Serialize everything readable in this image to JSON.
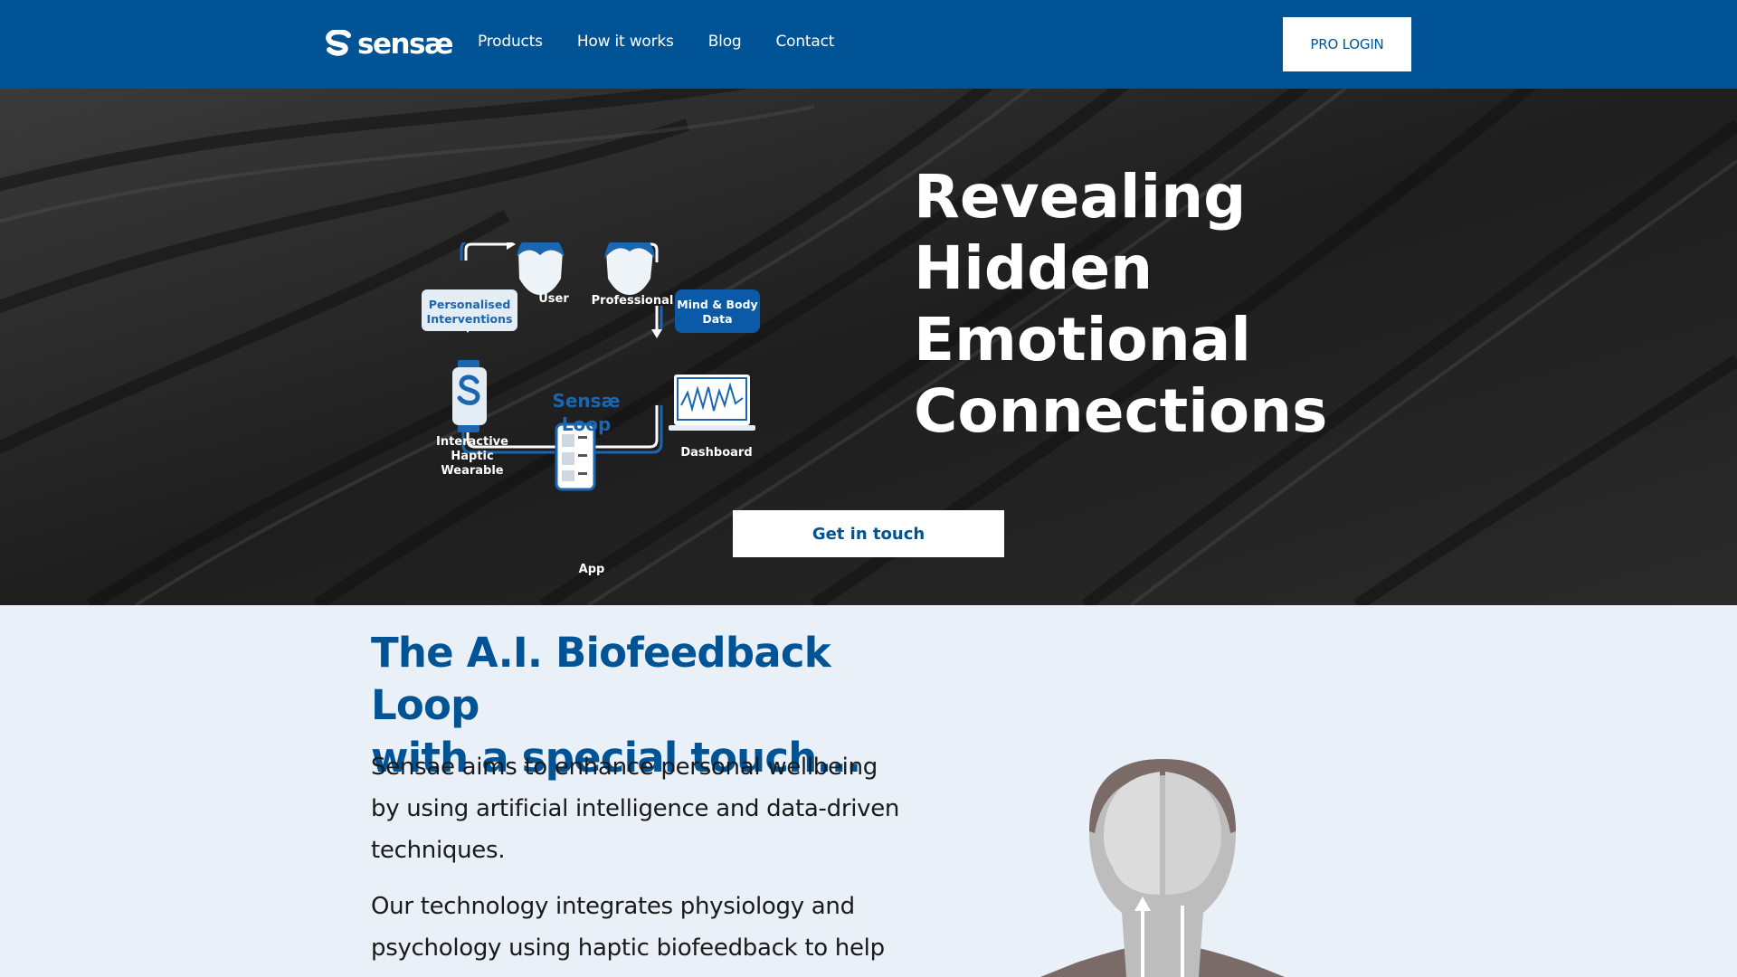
{
  "nav": {
    "logo_text": "sensæ",
    "links": [
      "Products",
      "How it works",
      "Blog",
      "Contact"
    ],
    "pro_login": "PRO LOGIN"
  },
  "hero": {
    "title_lines": [
      "Revealing",
      "Hidden",
      "Emotional",
      "Connections"
    ],
    "cta": "Get in touch",
    "diagram": {
      "center_line1": "Sensæ",
      "center_line2": "Loop",
      "user": "User",
      "professional": "Professional",
      "personalised_line1": "Personalised",
      "personalised_line2": "Interventions",
      "mindbody_line1": "Mind & Body",
      "mindbody_line2": "Data",
      "wearable_line1": "Interactive",
      "wearable_line2": "Haptic",
      "wearable_line3": "Wearable",
      "dashboard": "Dashboard",
      "app": "App"
    }
  },
  "section2": {
    "heading_line1": "The A.I. Biofeedback Loop",
    "heading_line2": "with a special touch...",
    "p1_line1": "Sensae aims to enhance personal wellbeing",
    "p1_line2": "by using artificial intelligence and data-driven",
    "p1_line3": "techniques.",
    "p2_line1": "Our technology integrates physiology and",
    "p2_line2": "psychology using haptic biofeedback to help"
  },
  "colors": {
    "brand_blue": "#005495",
    "hero_bg": "#232323",
    "section_bg": "#e9f0f8"
  }
}
